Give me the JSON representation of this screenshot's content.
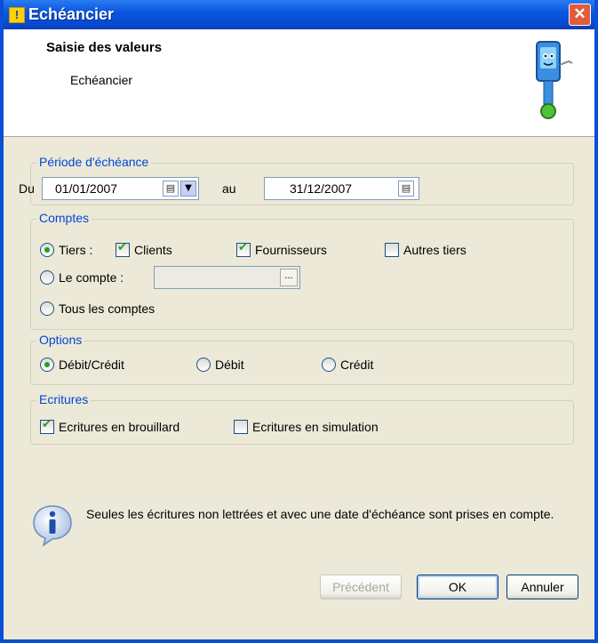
{
  "window": {
    "title": "Echéancier"
  },
  "header": {
    "title": "Saisie des valeurs",
    "subtitle": "Echéancier"
  },
  "periode": {
    "legend": "Période d'échéance",
    "du_label": "Du",
    "date_from": "01/01/2007",
    "au_label": "au",
    "date_to": "31/12/2007"
  },
  "comptes": {
    "legend": "Comptes",
    "tiers_label": "Tiers :",
    "tiers_selected": true,
    "clients_label": "Clients",
    "clients_checked": true,
    "fournisseurs_label": "Fournisseurs",
    "fournisseurs_checked": true,
    "autres_label": "Autres tiers",
    "autres_checked": false,
    "le_compte_label": "Le compte :",
    "compte_browse": "...",
    "tous_label": "Tous les comptes"
  },
  "options": {
    "legend": "Options",
    "debit_credit_label": "Débit/Crédit",
    "debit_label": "Débit",
    "credit_label": "Crédit",
    "selected": "Débit/Crédit"
  },
  "ecritures": {
    "legend": "Ecritures",
    "brouillard_label": "Ecritures en brouillard",
    "brouillard_checked": true,
    "simulation_label": "Ecritures en simulation",
    "simulation_checked": false
  },
  "info": {
    "text": "Seules les écritures non lettrées et avec une date d'échéance sont prises en compte."
  },
  "buttons": {
    "precedent": "Précédent",
    "ok": "OK",
    "annuler": "Annuler"
  }
}
